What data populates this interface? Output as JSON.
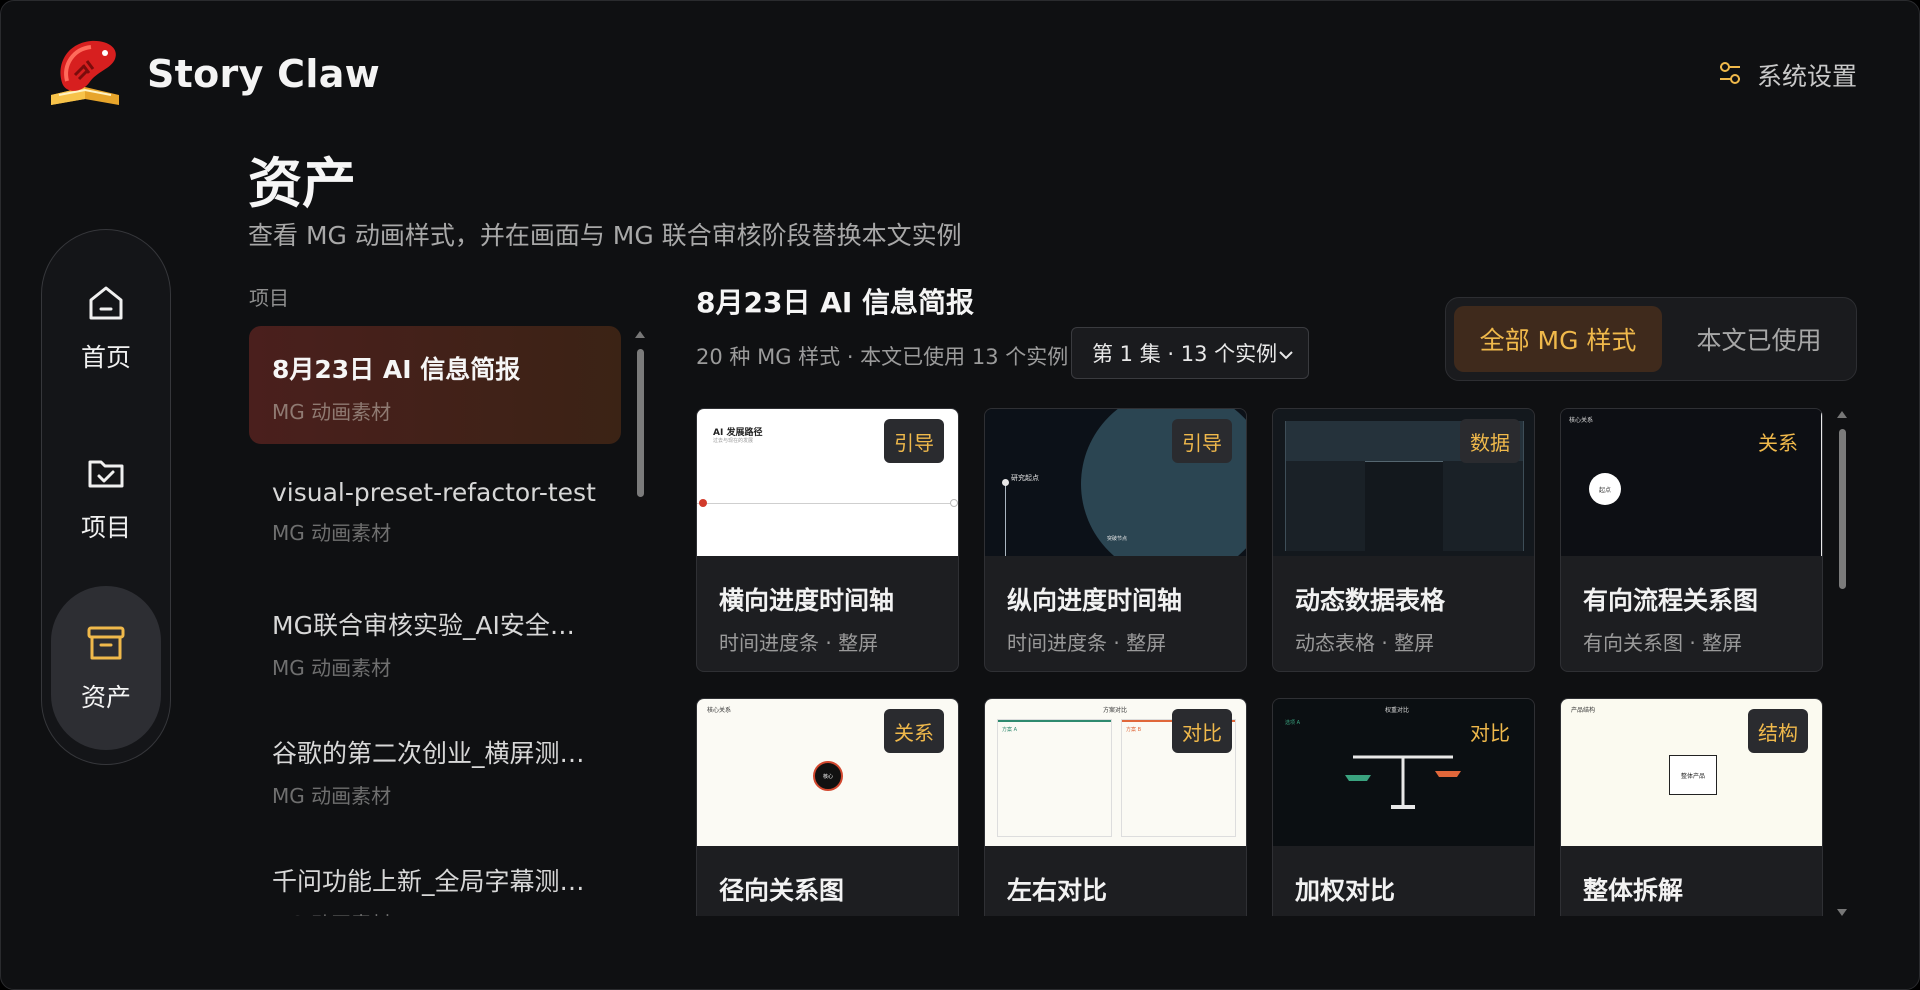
{
  "app": {
    "name": "Story Claw",
    "settings_label": "系统设置"
  },
  "nav": [
    {
      "label": "首页",
      "icon": "home-icon"
    },
    {
      "label": "项目",
      "icon": "folder-check-icon"
    },
    {
      "label": "资产",
      "icon": "archive-icon",
      "active": true
    }
  ],
  "page": {
    "title": "资产",
    "subtitle": "查看 MG 动画样式，并在画面与 MG 联合审核阶段替换本文实例"
  },
  "projects": {
    "heading": "项目",
    "items": [
      {
        "name": "8月23日 AI 信息简报",
        "type": "MG 动画素材",
        "active": true
      },
      {
        "name": "visual-preset-refactor-test",
        "type": "MG 动画素材"
      },
      {
        "name": "MG联合审核实验_AI安全评...",
        "type": "MG 动画素材"
      },
      {
        "name": "谷歌的第二次创业_横屏测试...",
        "type": "MG 动画素材"
      },
      {
        "name": "千问功能上新_全局字幕测试...",
        "type": "MG 动画素材"
      }
    ]
  },
  "detail": {
    "title": "8月23日 AI 信息简报",
    "meta": "20 种 MG 样式 · 本文已使用 13 个实例",
    "episode_select": "第 1 集 · 13 个实例"
  },
  "toggle": {
    "all": "全部 MG 样式",
    "used": "本文已使用"
  },
  "colors": {
    "accent": "#f0b94b",
    "background": "#0f1012",
    "card": "#1d1e21",
    "active_project": "#4a1f1d"
  },
  "cards": [
    {
      "title": "横向进度时间轴",
      "sub": "时间进度条 · 整屏",
      "badge": "引导",
      "thumb_text": "AI 发展路径",
      "thumb_note": "过去与现在的发展"
    },
    {
      "title": "纵向进度时间轴",
      "sub": "时间进度条 · 整屏",
      "badge": "引导",
      "thumb_text": "研究起点",
      "thumb_note": "突破节点"
    },
    {
      "title": "动态数据表格",
      "sub": "动态表格 · 整屏",
      "badge": "数据"
    },
    {
      "title": "有向流程关系图",
      "sub": "有向关系图 · 整屏",
      "badge": "关系",
      "thumb_text": "核心关系",
      "thumb_note": "起点"
    },
    {
      "title": "径向关系图",
      "sub": "",
      "badge": "关系",
      "thumb_text": "核心关系",
      "thumb_note": "核心"
    },
    {
      "title": "左右对比",
      "sub": "",
      "badge": "对比",
      "thumb_text": "方案对比",
      "thumb_note": "方案 A",
      "thumb_note2": "方案 B"
    },
    {
      "title": "加权对比",
      "sub": "",
      "badge": "对比",
      "thumb_text": "权重对比",
      "thumb_note": "选项 A"
    },
    {
      "title": "整体拆解",
      "sub": "",
      "badge": "结构",
      "thumb_text": "产品结构",
      "thumb_note": "整体产品"
    }
  ]
}
